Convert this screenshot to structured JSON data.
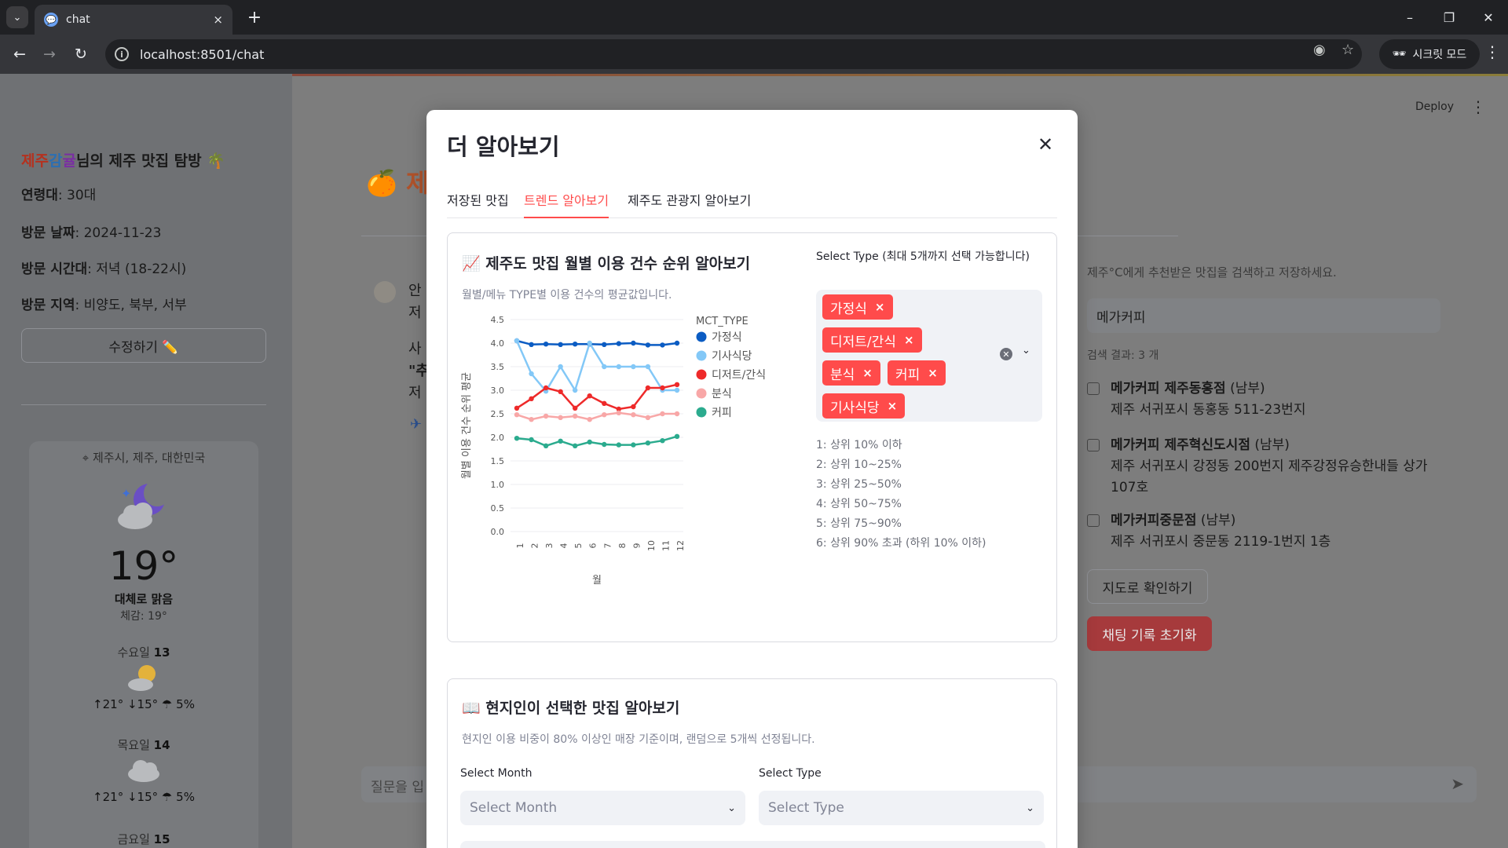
{
  "browser": {
    "tab_title": "chat",
    "url": "localhost:8501/chat",
    "incognito_label": "시크릿 모드",
    "tab_close_icon": "×",
    "new_tab_icon": "+"
  },
  "app": {
    "deploy_label": "Deploy"
  },
  "sidebar": {
    "greet_c1": "제주",
    "greet_c2": "감",
    "greet_c3": "귤",
    "greet_suffix": "님의 제주 맛집 탐방 🌴",
    "age_label": "연령대",
    "age_value": ": 30대",
    "date_label": "방문 날짜",
    "date_value": ": 2024-11-23",
    "time_label": "방문 시간대",
    "time_value": ": 저녁 (18-22시)",
    "region_label": "방문 지역",
    "region_value": ": 비양도, 북부, 서부",
    "edit_button": "수정하기 ✏️"
  },
  "weather": {
    "location": "제주시, 제주, 대한민국",
    "temp": "19°",
    "desc": "대체로 맑음",
    "feels": "체감: 19°",
    "days": [
      {
        "name": "수요일",
        "date": "13",
        "high": "21°",
        "low": "15°",
        "rain": "5%"
      },
      {
        "name": "목요일",
        "date": "14",
        "high": "21°",
        "low": "15°",
        "rain": "5%"
      },
      {
        "name": "금요일",
        "date": "15"
      }
    ]
  },
  "main": {
    "title_visible": "🍊 제주",
    "chat_frag_1": "안",
    "chat_frag_2": "저",
    "chat_frag_3": "사",
    "chat_frag_4": "\"추",
    "chat_frag_5": "저",
    "right_caption": "제주°C에게 추천받은 맛집을 검색하고 저장하세요.",
    "search_value": "메가커피",
    "result_count": "검색 결과: 3 개",
    "results": [
      {
        "name": "메가커피 제주동홍점",
        "region": " (남부)",
        "addr": "제주 서귀포시 동홍동 511-23번지"
      },
      {
        "name": "메가커피 제주혁신도시점",
        "region": " (남부)",
        "addr": "제주 서귀포시 강정동 200번지 제주강정유승한내들 상가 107호"
      },
      {
        "name": "메가커피중문점",
        "region": " (남부)",
        "addr": "제주 서귀포시 중문동 2119-1번지 1층"
      }
    ],
    "map_button": "지도로 확인하기",
    "reset_button": "채팅 기록 초기화",
    "chat_placeholder": "질문을 입"
  },
  "modal": {
    "title": "더 알아보기",
    "tabs": [
      "저장된 맛집",
      "트렌드 알아보기",
      "제주도 관광지 알아보기"
    ],
    "active_tab": 1,
    "card1": {
      "title": "📈 제주도 맛집 월별 이용 건수 순위 알아보기",
      "caption": "월별/메뉴 TYPE별 이용 건수의 평균값입니다.",
      "select_label": "Select Type (최대 5개까지 선택 가능합니다)",
      "chips": [
        "가정식",
        "디저트/간식",
        "분식",
        "커피",
        "기사식당"
      ],
      "legend_notes": [
        "1: 상위 10% 이하",
        "2: 상위 10~25%",
        "3: 상위 25~50%",
        "4: 상위 50~75%",
        "5: 상위 75~90%",
        "6: 상위 90% 초과 (하위 10% 이하)"
      ]
    },
    "card2": {
      "title": "📖 현지인이 선택한 맛집 알아보기",
      "caption": "현지인 이용 비중이 80% 이상인 매장 기준이며, 랜덤으로 5개씩 선정됩니다.",
      "month_label": "Select Month",
      "month_placeholder": "Select Month",
      "type_label": "Select Type",
      "type_placeholder": "Select Type"
    }
  },
  "chart_data": {
    "type": "line",
    "xlabel": "월",
    "ylabel": "월별 이용 건수 순위 평균",
    "legend_title": "MCT_TYPE",
    "legend_position": "right",
    "x": [
      1,
      2,
      3,
      4,
      5,
      6,
      7,
      8,
      9,
      10,
      11,
      12
    ],
    "ylim": [
      0,
      4.5
    ],
    "yticks": [
      "0.0",
      "0.5",
      "1.0",
      "1.5",
      "2.0",
      "2.5",
      "3.0",
      "3.5",
      "4.0",
      "4.5"
    ],
    "xticks": [
      "1",
      "2",
      "3",
      "4",
      "5",
      "6",
      "7",
      "8",
      "9",
      "10",
      "11",
      "12"
    ],
    "series": [
      {
        "name": "가정식",
        "color": "#0b5cc3",
        "values": [
          4.05,
          3.97,
          3.98,
          3.97,
          3.98,
          3.98,
          3.97,
          3.99,
          4.0,
          3.96,
          3.96,
          4.0
        ]
      },
      {
        "name": "기사식당",
        "color": "#83c8f7",
        "values": [
          4.05,
          3.35,
          2.98,
          3.5,
          3.0,
          4.0,
          3.5,
          3.5,
          3.5,
          3.5,
          3.0,
          3.0
        ]
      },
      {
        "name": "디저트/간식",
        "color": "#ee2a2a",
        "values": [
          2.62,
          2.82,
          3.05,
          2.97,
          2.62,
          2.88,
          2.72,
          2.6,
          2.65,
          3.05,
          3.05,
          3.12
        ]
      },
      {
        "name": "분식",
        "color": "#f8a7a7",
        "values": [
          2.48,
          2.38,
          2.45,
          2.42,
          2.45,
          2.38,
          2.48,
          2.52,
          2.48,
          2.42,
          2.5,
          2.5
        ]
      },
      {
        "name": "커피",
        "color": "#2bab8e",
        "values": [
          1.98,
          1.95,
          1.82,
          1.92,
          1.82,
          1.9,
          1.85,
          1.84,
          1.84,
          1.88,
          1.93,
          2.02
        ]
      }
    ]
  }
}
